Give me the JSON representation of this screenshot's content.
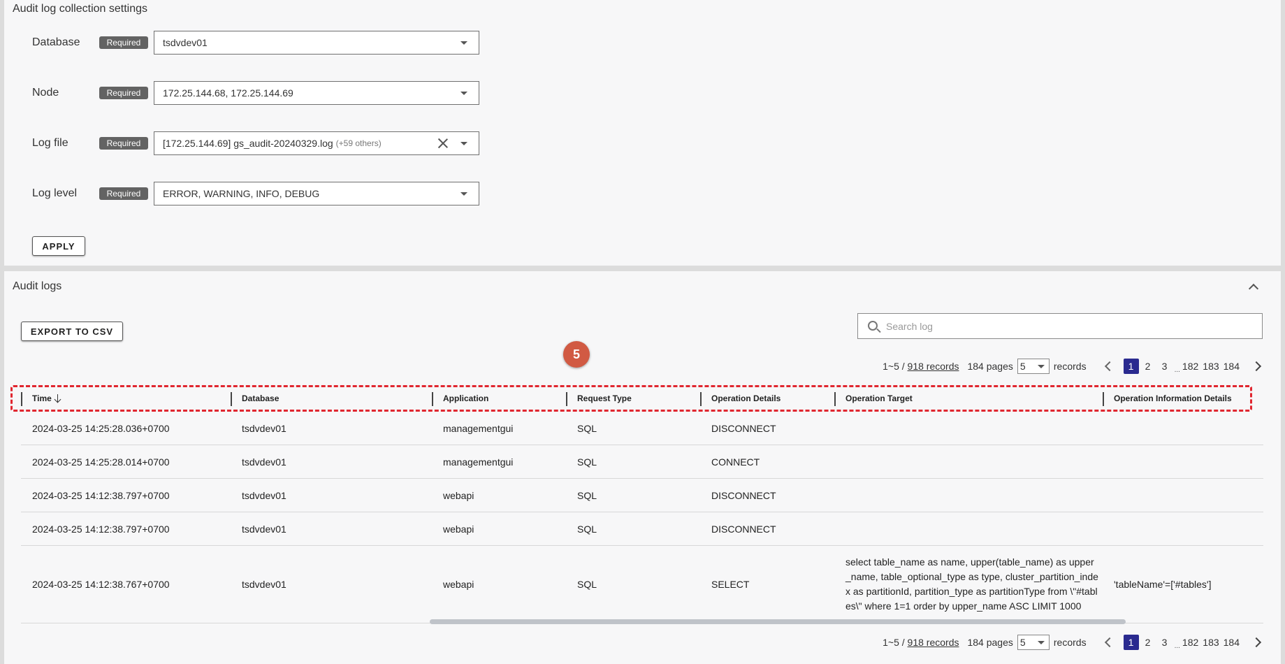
{
  "settings": {
    "title": "Audit log collection settings",
    "required_label": "Required",
    "fields": [
      {
        "label": "Database",
        "value": "tsdvdev01"
      },
      {
        "label": "Node",
        "value": "172.25.144.68, 172.25.144.69"
      },
      {
        "label": "Log file",
        "value": "[172.25.144.69] gs_audit-20240329.log",
        "extra": "(+59 others)"
      },
      {
        "label": "Log level",
        "value": "ERROR, WARNING, INFO, DEBUG"
      }
    ],
    "apply_label": "APPLY"
  },
  "logs": {
    "title": "Audit logs",
    "export_label": "EXPORT TO CSV",
    "search_placeholder": "Search log",
    "step_badge": "5",
    "pager": {
      "range": "1~5 /",
      "records_link": "918 records",
      "pages": "184 pages",
      "per_page": "5",
      "records_word": "records",
      "pages_list": [
        "1",
        "2",
        "3",
        "182",
        "183",
        "184"
      ],
      "ellipsis": "...",
      "active_page": "1"
    },
    "columns": [
      "Time",
      "Database",
      "Application",
      "Request Type",
      "Operation Details",
      "Operation Target",
      "Operation Information Details"
    ],
    "rows": [
      {
        "time": "2024-03-25 14:25:28.036+0700",
        "database": "tsdvdev01",
        "application": "managementgui",
        "request_type": "SQL",
        "operation_details": "DISCONNECT",
        "operation_target": "",
        "operation_info": ""
      },
      {
        "time": "2024-03-25 14:25:28.014+0700",
        "database": "tsdvdev01",
        "application": "managementgui",
        "request_type": "SQL",
        "operation_details": "CONNECT",
        "operation_target": "",
        "operation_info": ""
      },
      {
        "time": "2024-03-25 14:12:38.797+0700",
        "database": "tsdvdev01",
        "application": "webapi",
        "request_type": "SQL",
        "operation_details": "DISCONNECT",
        "operation_target": "",
        "operation_info": ""
      },
      {
        "time": "2024-03-25 14:12:38.797+0700",
        "database": "tsdvdev01",
        "application": "webapi",
        "request_type": "SQL",
        "operation_details": "DISCONNECT",
        "operation_target": "",
        "operation_info": ""
      },
      {
        "time": "2024-03-25 14:12:38.767+0700",
        "database": "tsdvdev01",
        "application": "webapi",
        "request_type": "SQL",
        "operation_details": "SELECT",
        "operation_target": "select  table_name as name, upper(table_name) as upper_name, table_optional_type as type, cluster_partition_index as partitionId, partition_type as partitionType from \\\"#tables\\\"  where 1=1  order by upper_name ASC LIMIT 1000",
        "operation_info": "'tableName'=['#tables']"
      }
    ]
  }
}
